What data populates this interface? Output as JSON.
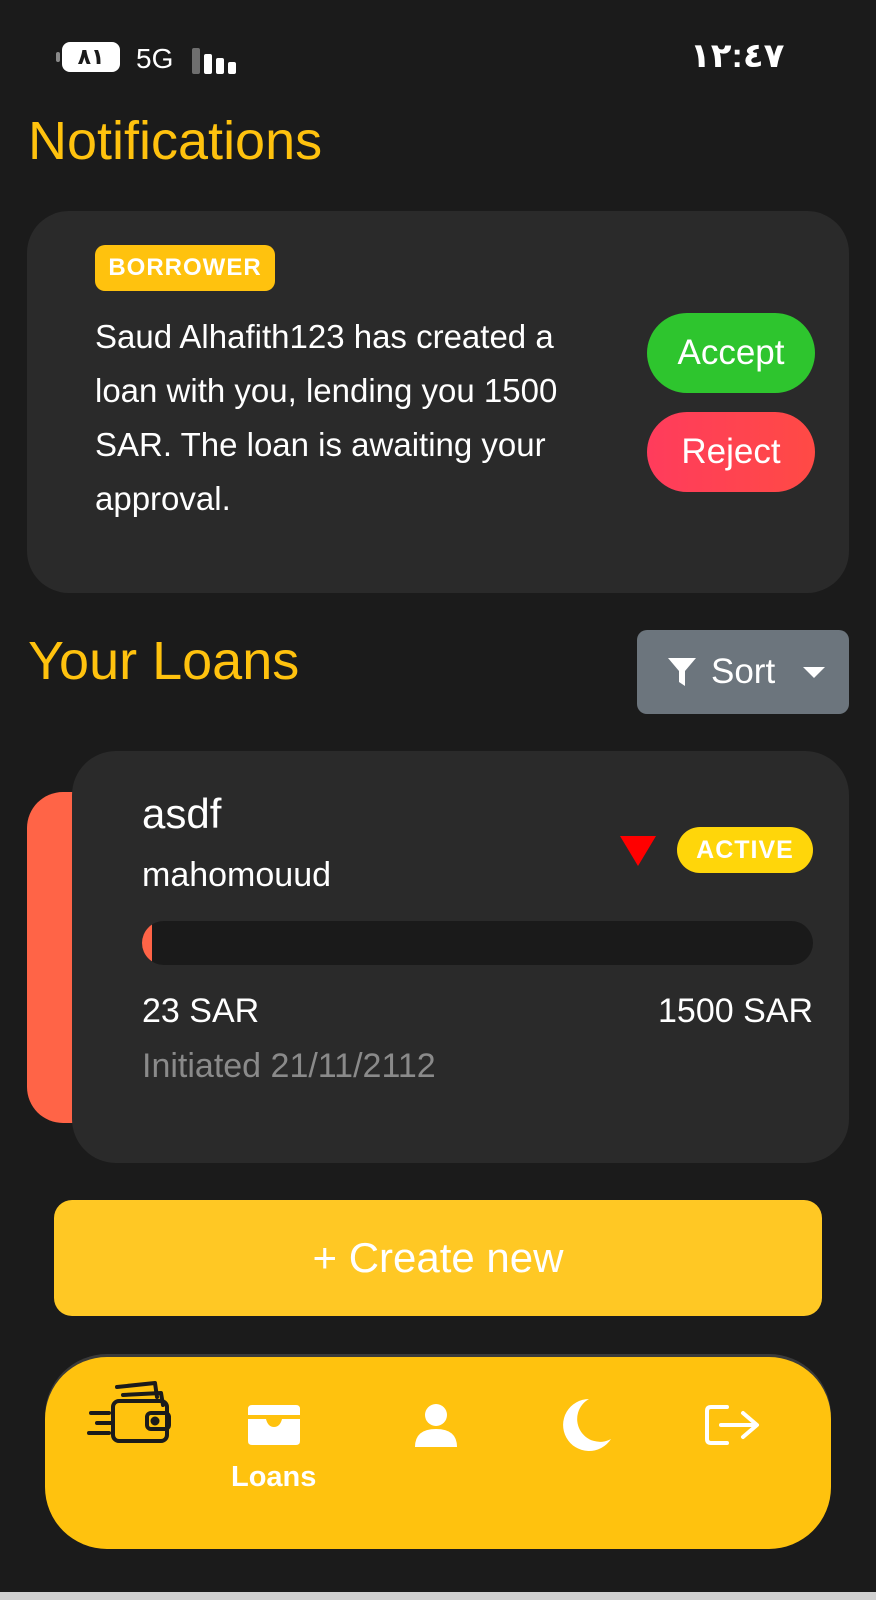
{
  "status_bar": {
    "battery": "٨١",
    "network": "5G",
    "time": "١٢:٤٧"
  },
  "notifications": {
    "heading": "Notifications",
    "items": [
      {
        "role": "BORROWER",
        "message": "Saud Alhafith123 has created a loan with you, lending you 1500 SAR. The loan is awaiting your approval.",
        "accept_label": "Accept",
        "reject_label": "Reject"
      }
    ]
  },
  "loans": {
    "heading": "Your Loans",
    "sort_label": "Sort",
    "items": [
      {
        "name": "asdf",
        "user": "mahomouud",
        "status": "ACTIVE",
        "trend_icon": "down-triangle-icon",
        "progress_fraction": 0.015,
        "paid": "23 SAR",
        "total": "1500 SAR",
        "initiated": "Initiated 21/11/2112"
      }
    ],
    "create_label": "+ Create new"
  },
  "bottom_nav": {
    "items": [
      {
        "icon": "wallet-cash-icon",
        "label": ""
      },
      {
        "icon": "wallet-icon",
        "label": "Loans"
      },
      {
        "icon": "user-icon",
        "label": ""
      },
      {
        "icon": "moon-icon",
        "label": ""
      },
      {
        "icon": "logout-icon",
        "label": ""
      }
    ]
  },
  "colors": {
    "accent": "#ffc20e",
    "background": "#1b1b1b",
    "card": "#2a2a2a",
    "accept": "#2ec52e",
    "reject": "#ff3c5c",
    "loan_accent": "#ff6447"
  }
}
